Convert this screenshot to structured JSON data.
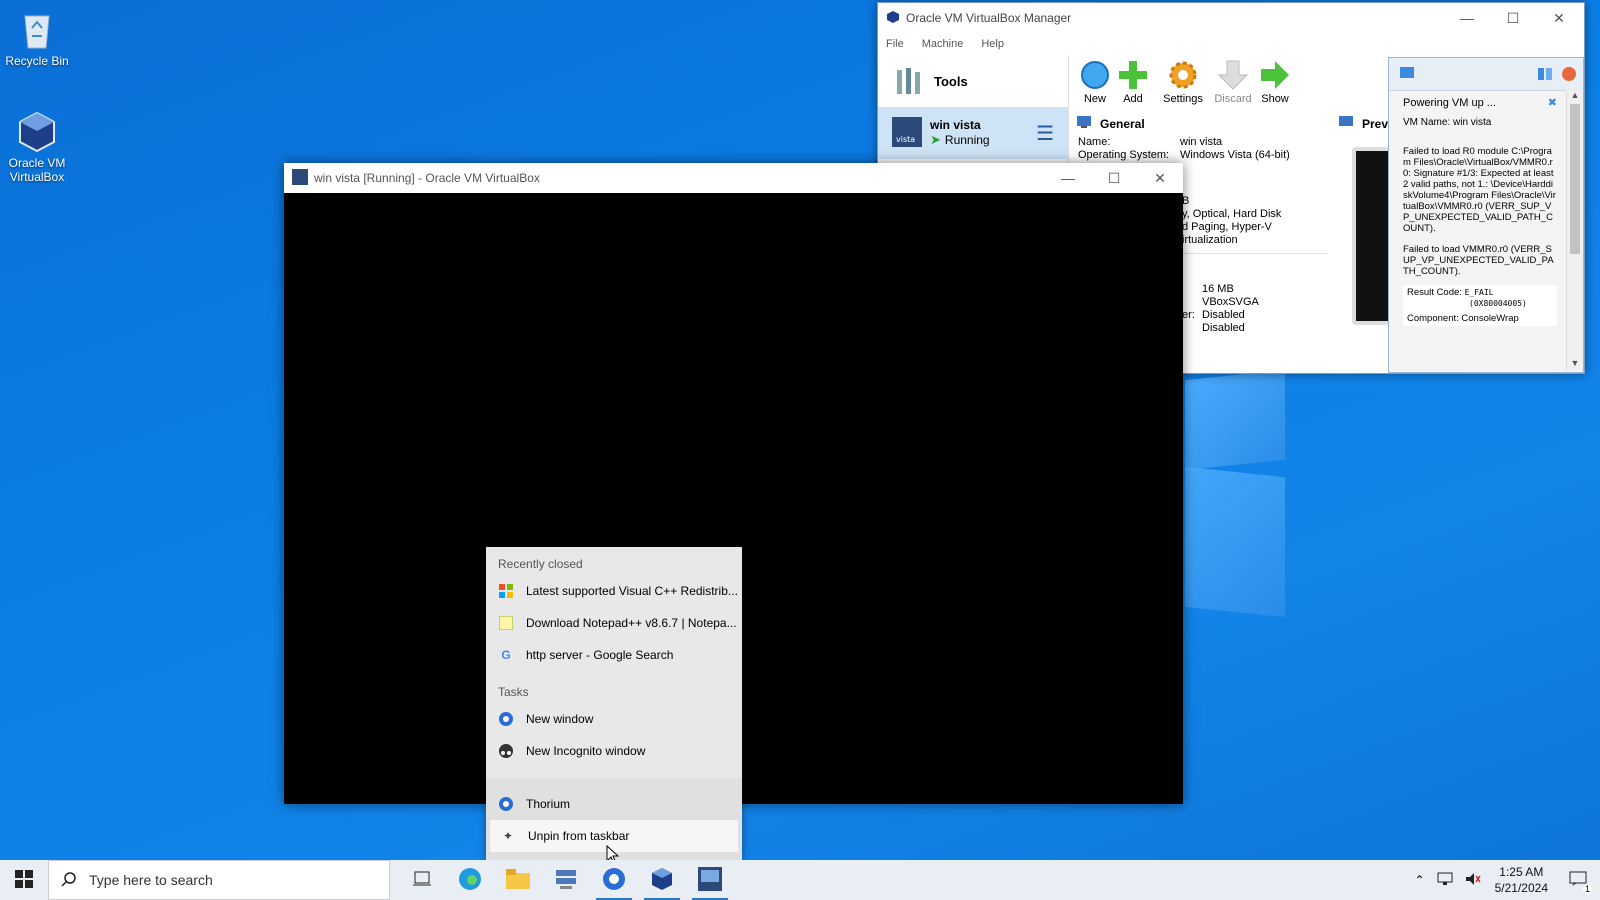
{
  "desktop": {
    "icons": [
      {
        "label": "Recycle Bin"
      },
      {
        "label": "Oracle VM VirtualBox"
      }
    ]
  },
  "vbox_manager": {
    "title": "Oracle VM VirtualBox Manager",
    "menu": [
      "File",
      "Machine",
      "Help"
    ],
    "tools_label": "Tools",
    "vm": {
      "name": "win vista",
      "status": "Running"
    },
    "toolbar": [
      "New",
      "Add",
      "Settings",
      "Discard",
      "Show"
    ],
    "general": {
      "header": "General",
      "name_key": "Name:",
      "name_val": "win vista",
      "os_key": "Operating System:",
      "os_val": "Windows Vista (64-bit)",
      "partial_1": "B",
      "partial_2": "y, Optical, Hard Disk",
      "partial_3": "d Paging, Hyper-V",
      "partial_4": "irtualization",
      "video_1": "16 MB",
      "video_2": "VBoxSVGA",
      "video_3k": "er:",
      "video_3": "Disabled",
      "video_4": "Disabled"
    },
    "preview_label": "Prev",
    "notification": {
      "title": "Powering VM up ...",
      "vm_name": "VM Name: win vista",
      "error_1": "Failed to load R0 module C:\\Program Files\\Oracle\\VirtualBox/VMMR0.r0: Signature #1/3: Expected at least 2 valid paths, not 1.: \\Device\\HarddiskVolume4\\Program Files\\Oracle\\VirtualBox\\VMMR0.r0 (VERR_SUP_VP_UNEXPECTED_VALID_PATH_COUNT).",
      "error_2": "Failed to load VMMR0.r0 (VERR_SUP_VP_UNEXPECTED_VALID_PATH_COUNT).",
      "result_label": "Result Code:",
      "result_code": "E_FAIL",
      "result_hex": "(0X80004005)",
      "component": "Component: ConsoleWrap"
    }
  },
  "vm_window": {
    "title": "win vista  [Running] - Oracle VM VirtualBox"
  },
  "jumplist": {
    "recent_header": "Recently closed",
    "recent": [
      "Latest supported Visual C++ Redistrib...",
      "Download Notepad++ v8.6.7 | Notepa...",
      "http server - Google Search"
    ],
    "tasks_header": "Tasks",
    "tasks": [
      "New window",
      "New Incognito window"
    ],
    "app": "Thorium",
    "unpin": "Unpin from taskbar"
  },
  "taskbar": {
    "search_placeholder": "Type here to search",
    "time": "1:25 AM",
    "date": "5/21/2024",
    "notif_count": "1"
  },
  "colors": {
    "accent": "#2a76c9",
    "desktop": "#0b7ee6"
  }
}
